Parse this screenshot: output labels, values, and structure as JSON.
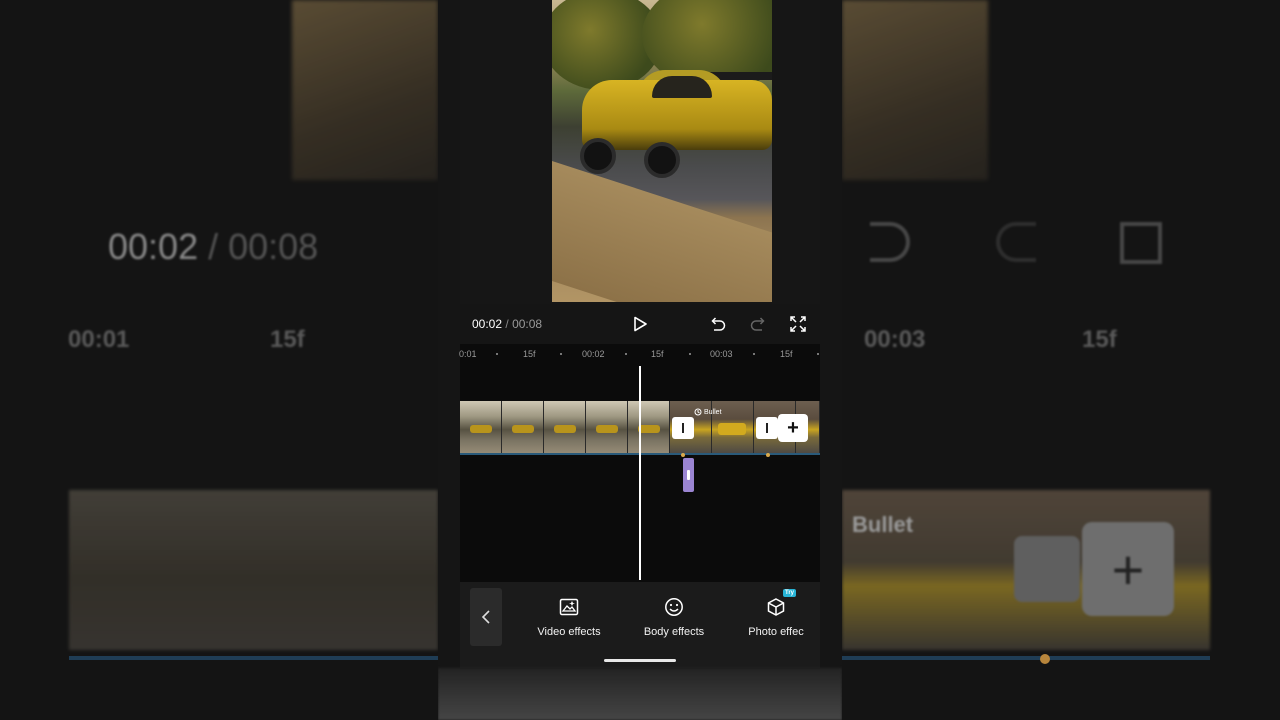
{
  "player": {
    "current_time": "00:02",
    "separator": "/",
    "total_time": "00:08"
  },
  "ruler": {
    "labels": [
      "0:01",
      "15f",
      "00:02",
      "15f",
      "00:03",
      "15f"
    ]
  },
  "timeline": {
    "transition_tag": "Bullet"
  },
  "toolbar": {
    "items": [
      {
        "label": "Video effects",
        "icon": "video-effects-icon"
      },
      {
        "label": "Body effects",
        "icon": "body-effects-icon"
      },
      {
        "label": "Photo effec",
        "icon": "photo-effects-icon",
        "badge": "Try"
      }
    ]
  },
  "backdrop": {
    "left_time_current": "00:02",
    "left_time_sep": " / ",
    "left_time_total": "00:08",
    "left_ruler": [
      "00:01",
      "15f"
    ],
    "right_ruler": [
      "00:03",
      "15f"
    ],
    "right_tag": "Bullet"
  },
  "colors": {
    "accent_line": "#2a5a7a",
    "effect_clip": "#9b85d2",
    "try_badge": "#27b4d6"
  }
}
